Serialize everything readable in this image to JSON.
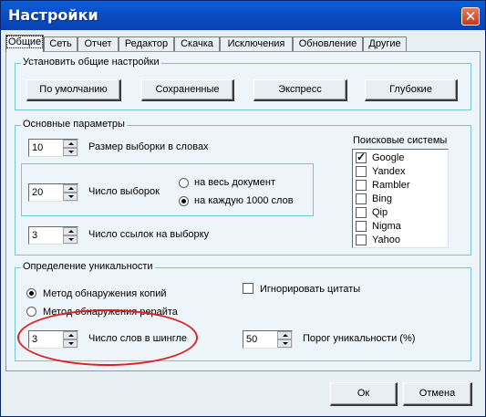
{
  "window": {
    "title": "Настройки",
    "close_glyph": "✕"
  },
  "tabs": [
    "Общие",
    "Сеть",
    "Отчет",
    "Редактор",
    "Скачка",
    "Исключения",
    "Обновление",
    "Другие"
  ],
  "presets": {
    "title": "Установить общие настройки",
    "buttons": [
      "По умолчанию",
      "Сохраненные",
      "Экспресс",
      "Глубокие"
    ]
  },
  "params": {
    "title": "Основные параметры",
    "sample_size": {
      "value": "10",
      "label": "Размер выборки в словах"
    },
    "samples": {
      "value": "20",
      "label": "Число выборок"
    },
    "scope": [
      {
        "label": "на весь документ",
        "selected": false
      },
      {
        "label": "на каждую 1000 слов",
        "selected": true
      }
    ],
    "links": {
      "value": "3",
      "label": "Число ссылок на выборку"
    },
    "search_engines": {
      "title": "Поисковые системы",
      "items": [
        {
          "label": "Google",
          "checked": true
        },
        {
          "label": "Yandex",
          "checked": false
        },
        {
          "label": "Rambler",
          "checked": false
        },
        {
          "label": "Bing",
          "checked": false
        },
        {
          "label": "Qip",
          "checked": false
        },
        {
          "label": "Nigma",
          "checked": false
        },
        {
          "label": "Yahoo",
          "checked": false
        }
      ]
    }
  },
  "uniqueness": {
    "title": "Определение уникальности",
    "methods": [
      {
        "label": "Метод обнаружения копий",
        "selected": true
      },
      {
        "label": "Метод обнаружения рерайта",
        "selected": false
      }
    ],
    "ignore_quotes": {
      "label": "Игнорировать цитаты",
      "checked": false
    },
    "shingle": {
      "value": "3",
      "label": "Число слов в шингле"
    },
    "threshold": {
      "value": "50",
      "label": "Порог уникальности (%)"
    }
  },
  "footer": {
    "ok": "Ок",
    "cancel": "Отмена"
  },
  "colors": {
    "titlebar": "#0a4fc8",
    "groupbox_border": "#77c3d8",
    "annotation_oval": "#dd2222"
  }
}
